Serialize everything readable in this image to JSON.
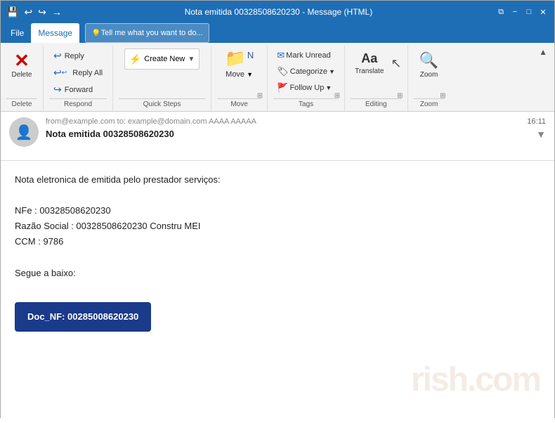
{
  "titlebar": {
    "title": "Nota emitida 00328508620230 - Message (HTML)",
    "save_icon": "💾",
    "undo_icon": "↩",
    "redo_icon": "↪",
    "arrow_icon": "→",
    "restore_icon": "❐",
    "minimize_icon": "−",
    "maximize_icon": "□",
    "close_icon": "✕",
    "restore_win_icon": "⧉"
  },
  "menubar": {
    "items": [
      "File",
      "Message"
    ],
    "active": "Message",
    "search_placeholder": "Tell me what you want to do..."
  },
  "ribbon": {
    "groups": {
      "delete": {
        "label": "Delete",
        "delete_icon": "✕",
        "delete_label": "Delete"
      },
      "respond": {
        "label": "Respond",
        "reply_icon": "↩",
        "reply_label": "Reply",
        "reply_all_icon": "↩↩",
        "reply_all_label": "Reply All",
        "forward_icon": "↪",
        "forward_label": "Forward"
      },
      "quick_steps": {
        "label": "Quick Steps",
        "create_icon": "⚡",
        "create_label": "Create New",
        "expand_icon": "▼"
      },
      "move": {
        "label": "Move",
        "move_icon": "📁",
        "move_label": "Move",
        "rules_icon": "▦",
        "onenote_icon": "N",
        "arrow_icon": "▼",
        "expand_icon": "⊞"
      },
      "tags": {
        "label": "Tags",
        "mark_unread_icon": "✉",
        "mark_unread_label": "Mark Unread",
        "categorize_icon": "🏷",
        "categorize_label": "Categorize",
        "follow_up_icon": "🚩",
        "follow_up_label": "Follow Up",
        "expand_icon": "⊞"
      },
      "editing": {
        "label": "Editing",
        "translate_icon": "Aa",
        "translate_label": "Translate",
        "cursor_icon": "↖",
        "expand_icon": "⊞"
      },
      "zoom": {
        "label": "Zoom",
        "zoom_icon": "🔍",
        "zoom_label": "Zoom",
        "expand_icon": "⊞"
      }
    }
  },
  "email": {
    "from": "from@example.com  to: example@domain.com  AAAA AAAAA",
    "subject": "Nota emitida 00328508620230",
    "time": "16:11",
    "body": {
      "line1": "Nota eletronica de emitida pelo prestador serviços:",
      "line2": "",
      "line3": "NFe : 00328508620230",
      "line4": "Razão Social : 00328508620230 Constru MEI",
      "line5": "CCM : 9786",
      "line6": "",
      "line7": "Segue a baixo:",
      "button_label": "Doc_NF: 00285008620230"
    }
  }
}
